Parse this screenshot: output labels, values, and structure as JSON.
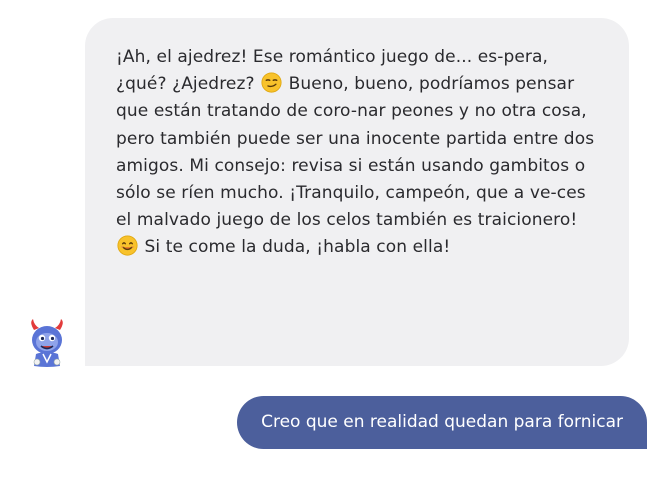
{
  "conversation": {
    "bot_message": {
      "part1": "¡Ah, el ajedrez! Ese romántico juego de... es-pera, ¿qué? ¿Ajedrez?",
      "part2": "Bueno, bueno, podríamos pensar que están tratando de coro-nar peones y no otra cosa, pero también puede ser una inocente partida entre dos amigos. Mi consejo: revisa si están usando gambitos o sólo se ríen mucho. ¡Tranquilo, campeón, que a ve-ces el malvado juego de los celos también es traicionero!",
      "part3": "Si te come la duda, ¡habla con ella!",
      "emoji_1": "smirk-face-emoji",
      "emoji_2": "smiling-face-emoji"
    },
    "user_message": "Creo que en realidad quedan para fornicar"
  },
  "colors": {
    "bot_bubble": "#f0f0f2",
    "user_bubble": "#4c5f9c",
    "bot_text": "#2a2a2e",
    "user_text": "#ffffff",
    "avatar_body": "#5a74d6",
    "avatar_horns": "#e23b3b",
    "emoji_yellow": "#f8c22b"
  }
}
